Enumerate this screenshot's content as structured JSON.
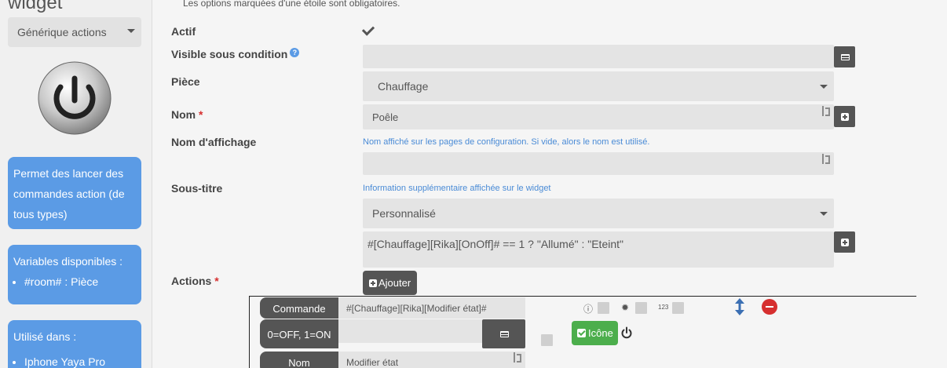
{
  "sidebar": {
    "title": "widget",
    "type_select": "Générique actions",
    "description": "Permet des lancer des commandes action (de tous types)",
    "variables_title": "Variables disponibles :",
    "variables": [
      "#room# : Pièce"
    ],
    "used_in_title": "Utilisé dans :",
    "used_in": [
      "Iphone Yaya Pro"
    ]
  },
  "form": {
    "required_note": "Les options marquées d'une étoile sont obligatoires.",
    "actif_label": "Actif",
    "actif_checked": true,
    "visible_label": "Visible sous condition",
    "visible_value": "",
    "piece_label": "Pièce",
    "piece_value": "Chauffage",
    "nom_label": "Nom",
    "nom_value": "Poêle",
    "nom_affichage_label": "Nom d'affichage",
    "nom_affichage_hint": "Nom affiché sur les pages de configuration. Si vide, alors le nom est utilisé.",
    "nom_affichage_value": "",
    "sous_titre_label": "Sous-titre",
    "sous_titre_hint": "Information supplémentaire affichée sur le widget",
    "sous_titre_mode": "Personnalisé",
    "sous_titre_expr": "#[Chauffage][Rika][OnOff]# == 1 ? \"Allumé\" : \"Eteint\"",
    "actions_label": "Actions",
    "required_star": "*",
    "add_button": "Ajouter"
  },
  "action_row": {
    "commande_label": "Commande",
    "commande_value": "#[Chauffage][Rika][Modifier état]#",
    "values_label": "0=OFF, 1=ON",
    "values_value": "",
    "nom_label": "Nom",
    "nom_value": "Modifier état",
    "confirm_icon": "question-circle-icon",
    "secure_icon": "fingerprint-icon",
    "code_icon_text": "123",
    "icon_button": "Icône",
    "selected_icon": "power-icon"
  },
  "colors": {
    "accent_blue": "#5b9be5",
    "dark_button": "#555555",
    "success_green": "#4cae4c",
    "danger_red": "#d62f2f"
  }
}
